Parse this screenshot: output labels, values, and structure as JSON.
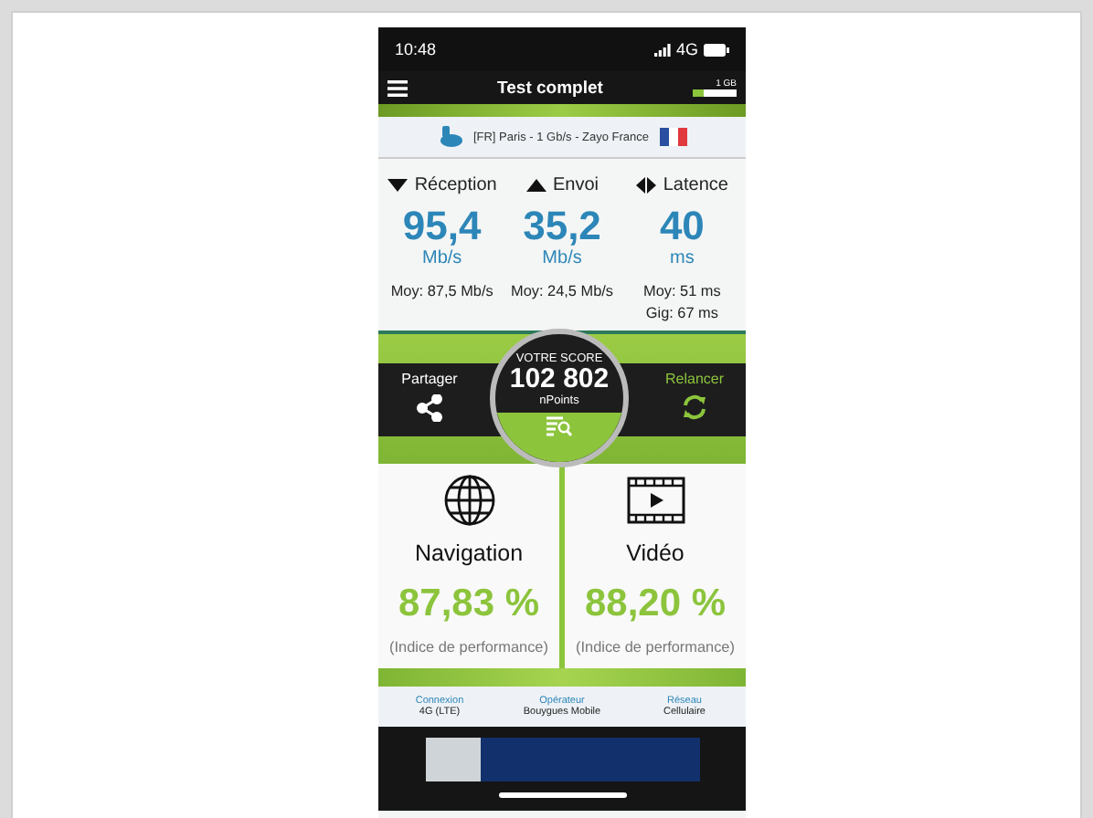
{
  "status_bar": {
    "time": "10:48",
    "network": "4G"
  },
  "header": {
    "title": "Test complet",
    "badge": "1 GB"
  },
  "server": {
    "label": "[FR] Paris - 1 Gb/s - Zayo France"
  },
  "stats": [
    {
      "kind": "down",
      "label": "Réception",
      "value": "95,4",
      "unit": "Mb/s",
      "details": [
        "Moy: 87,5 Mb/s"
      ]
    },
    {
      "kind": "up",
      "label": "Envoi",
      "value": "35,2",
      "unit": "Mb/s",
      "details": [
        "Moy: 24,5 Mb/s"
      ]
    },
    {
      "kind": "latency",
      "label": "Latence",
      "value": "40",
      "unit": "ms",
      "details": [
        "Moy: 51 ms",
        "Gig: 67 ms"
      ]
    }
  ],
  "score": {
    "caption": "VOTRE SCORE",
    "value": "102 802",
    "unit": "nPoints"
  },
  "actions": [
    {
      "kind": "share",
      "label": "Partager"
    },
    {
      "kind": "restart",
      "label": "Relancer"
    }
  ],
  "cards": [
    {
      "kind": "web",
      "title": "Navigation",
      "value": "87,83 %",
      "note": "(Indice de performance)"
    },
    {
      "kind": "video",
      "title": "Vidéo",
      "value": "88,20 %",
      "note": "(Indice de performance)"
    }
  ],
  "info": [
    {
      "label": "Connexion",
      "value": "4G (LTE)"
    },
    {
      "label": "Opérateur",
      "value": "Bouygues Mobile"
    },
    {
      "label": "Réseau",
      "value": "Cellulaire"
    }
  ]
}
